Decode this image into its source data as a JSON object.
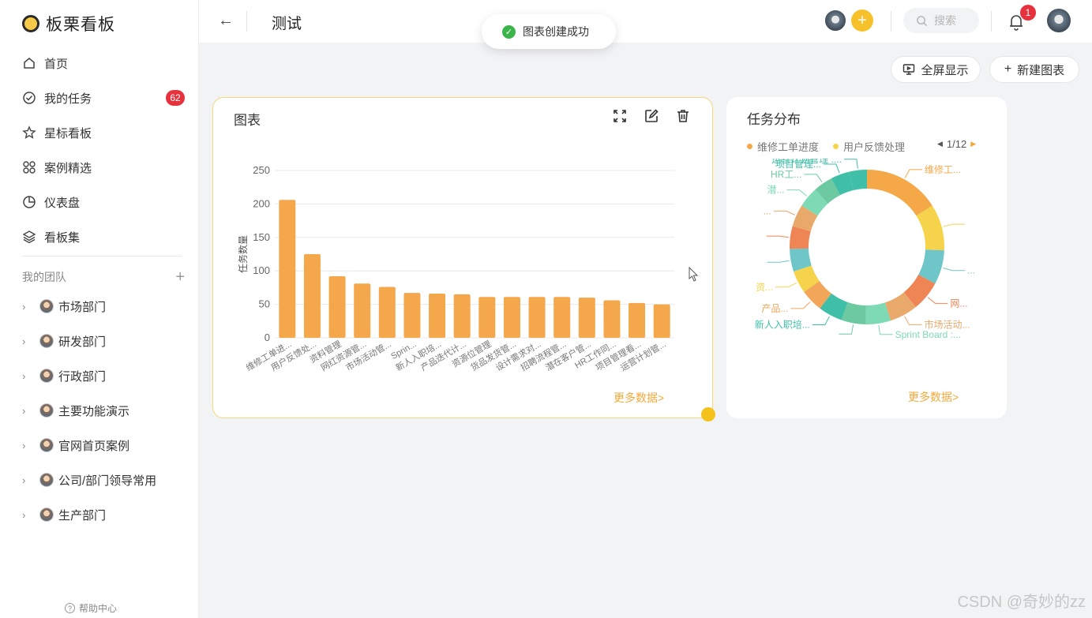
{
  "app": {
    "name": "板栗看板"
  },
  "sidebar": {
    "nav": [
      {
        "label": "首页",
        "icon": "home-icon"
      },
      {
        "label": "我的任务",
        "icon": "task-check-icon",
        "badge": "62"
      },
      {
        "label": "星标看板",
        "icon": "star-icon"
      },
      {
        "label": "案例精选",
        "icon": "grid-icon"
      },
      {
        "label": "仪表盘",
        "icon": "pie-icon"
      },
      {
        "label": "看板集",
        "icon": "layers-icon"
      }
    ],
    "team_header": "我的团队",
    "teams": [
      {
        "label": "市场部门"
      },
      {
        "label": "研发部门"
      },
      {
        "label": "行政部门"
      },
      {
        "label": "主要功能演示"
      },
      {
        "label": "官网首页案例"
      },
      {
        "label": "公司/部门领导常用"
      },
      {
        "label": "生产部门"
      }
    ],
    "help": "帮助中心"
  },
  "header": {
    "title": "测试",
    "search_placeholder": "搜索",
    "notification_count": "1"
  },
  "toast": {
    "text": "图表创建成功"
  },
  "toolbar": {
    "fullscreen": "全屏显示",
    "new_chart": "新建图表"
  },
  "bar_card": {
    "title": "图表",
    "more": "更多数据>"
  },
  "pie_card": {
    "title": "任务分布",
    "legend": [
      {
        "label": "维修工单进度",
        "color": "#f4a847"
      },
      {
        "label": "用户反馈处理",
        "color": "#f5d34a"
      }
    ],
    "pager": "1/12",
    "more": "更多数据>"
  },
  "chart_data": [
    {
      "type": "bar",
      "title": "图表",
      "ylabel": "任务数量",
      "ylim": [
        0,
        250
      ],
      "yticks": [
        0,
        50,
        100,
        150,
        200,
        250
      ],
      "grid": true,
      "color": "#f5a84b",
      "categories": [
        "维修工单进...",
        "用户反馈处...",
        "资料管理",
        "网红资源管...",
        "市场活动管...",
        "Sprin...",
        "新人入职培...",
        "产品迭代计...",
        "资源位管理",
        "货品发货管...",
        "设计需求对...",
        "招聘流程管...",
        "潜在客户管...",
        "HR工作同...",
        "项目管理看...",
        "运营计划管..."
      ],
      "values": [
        206,
        125,
        92,
        81,
        76,
        67,
        66,
        65,
        61,
        61,
        61,
        61,
        60,
        56,
        52,
        50
      ]
    },
    {
      "type": "pie",
      "title": "任务分布",
      "donut": true,
      "legend_position": "top",
      "labels": [
        "维修工...",
        "",
        "...",
        "网...",
        "市场活动...",
        "Sprint Board :...",
        "",
        "新人入职培...",
        "产品...",
        "资...",
        "",
        "",
        "...",
        "潜...",
        "HR工...",
        "项目管理...",
        "运营计划管理 :..."
      ],
      "values": [
        206,
        125,
        92,
        81,
        76,
        67,
        66,
        65,
        61,
        61,
        61,
        61,
        60,
        56,
        52,
        50,
        48
      ],
      "colors": [
        "#f4a847",
        "#f5d34a",
        "#6ec6c8",
        "#ef8455",
        "#e8a96a",
        "#7ed9b5",
        "#6cc9a0",
        "#3fbfa8",
        "#f2a65a",
        "#f5d34a",
        "#6ec6c8",
        "#ef8455",
        "#e8a96a",
        "#7ed9b5",
        "#6cc9a0",
        "#3fbfa8",
        "#3fbfa8"
      ]
    }
  ],
  "watermark": "CSDN @奇妙的zz"
}
